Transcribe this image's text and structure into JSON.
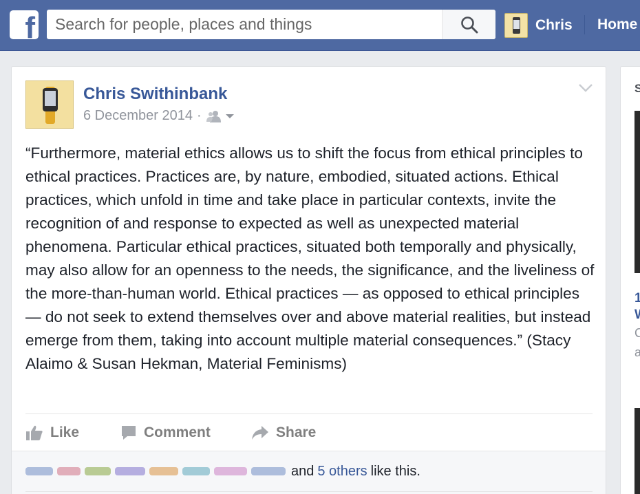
{
  "topbar": {
    "logo": "f",
    "search_placeholder": "Search for people, places and things",
    "search_icon": "search-icon",
    "user_name": "Chris",
    "home_label": "Home"
  },
  "post": {
    "author": "Chris Swithinbank",
    "date": "6 December 2014",
    "dot": "·",
    "audience_icon": "friends-audience-icon",
    "text": "“Furthermore, material ethics allows us to shift the focus from ethical principles to ethical practices. Practices are, by nature, embodied, situated actions. Ethical practices, which unfold in time and take place in particular contexts, invite the recognition of and response to expected as well as unexpected material phenomena. Particular ethical practices, situated both temporally and physically, may also allow for an openness to the needs, the significance, and the liveliness of the more-than-human world. Ethical practices — as opposed to ethical principles — do not seek to extend themselves over and above material realities, but instead emerge from them, taking into account multiple material consequences.” (Stacy Alaimo & Susan Hekman, Material Feminisms)",
    "actions": {
      "like": "Like",
      "comment": "Comment",
      "share": "Share"
    },
    "likes": {
      "and": "and",
      "others_link": "5 others",
      "suffix": "like this."
    }
  },
  "sidebar": {
    "header": "S",
    "item_number": "1",
    "item_title": "W",
    "item_line1": "C",
    "item_line2": "a"
  },
  "colors": {
    "topbar": "#4e69a2",
    "link": "#385898",
    "background": "#e9ebee"
  }
}
